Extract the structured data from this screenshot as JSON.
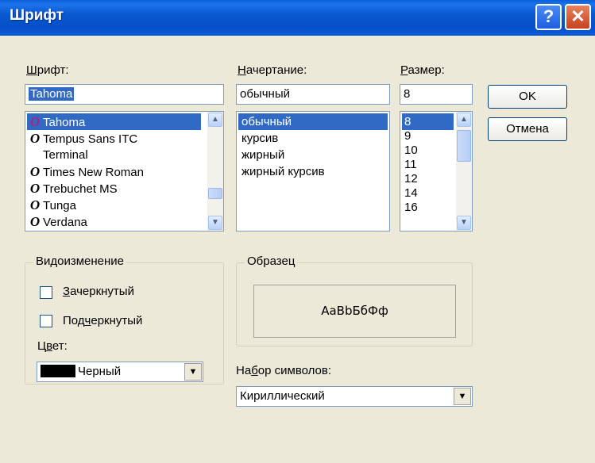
{
  "window": {
    "title": "Шрифт",
    "help_glyph": "?",
    "close_glyph": "✕",
    "titlebar_color": "#0A5AD8"
  },
  "font": {
    "label_accel": "Ш",
    "label_rest": "рифт:",
    "value": "Tahoma",
    "items": [
      {
        "name": "Tahoma",
        "icon": "O",
        "selected": true
      },
      {
        "name": "Tempus Sans ITC",
        "icon": "O"
      },
      {
        "name": "Terminal",
        "icon": ""
      },
      {
        "name": "Times New Roman",
        "icon": "O"
      },
      {
        "name": "Trebuchet MS",
        "icon": "O"
      },
      {
        "name": "Tunga",
        "icon": "O"
      },
      {
        "name": "Verdana",
        "icon": "O"
      }
    ]
  },
  "style": {
    "label_accel": "Н",
    "label_rest": "ачертание:",
    "value": "обычный",
    "items": [
      {
        "name": "обычный",
        "selected": true
      },
      {
        "name": "курсив"
      },
      {
        "name": "жирный"
      },
      {
        "name": "жирный курсив"
      }
    ]
  },
  "size": {
    "label_accel": "Р",
    "label_rest": "азмер:",
    "value": "8",
    "items": [
      {
        "name": "8",
        "selected": true
      },
      {
        "name": "9"
      },
      {
        "name": "10"
      },
      {
        "name": "11"
      },
      {
        "name": "12"
      },
      {
        "name": "14"
      },
      {
        "name": "16"
      }
    ]
  },
  "buttons": {
    "ok": "OK",
    "cancel": "Отмена"
  },
  "effects": {
    "legend": "Видоизменение",
    "strikeout_accel": "З",
    "strikeout_rest": "ачеркнутый",
    "underline_pre": "Под",
    "underline_accel": "ч",
    "underline_rest": "еркнутый",
    "color_pre": "Ц",
    "color_accel": "в",
    "color_rest": "ет:",
    "color_value": "Черный",
    "color_swatch": "#000000"
  },
  "sample": {
    "legend": "Образец",
    "text": "AaBbБбФф"
  },
  "charset": {
    "label_pre": "На",
    "label_accel": "б",
    "label_rest": "ор символов:",
    "value": "Кириллический"
  },
  "icons": {
    "font_type": "opentype-font-icon",
    "scroll_up": "scroll-up-icon",
    "scroll_down": "scroll-down-icon",
    "dropdown": "chevron-down-icon"
  }
}
